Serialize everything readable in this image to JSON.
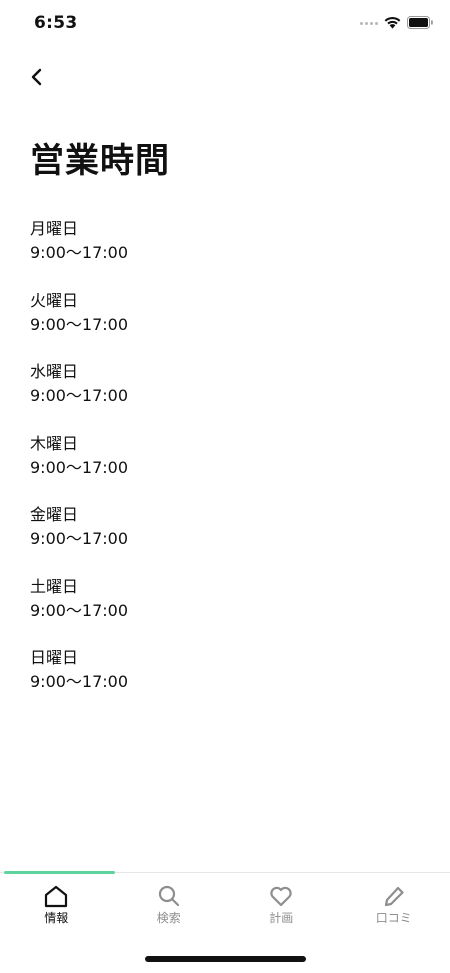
{
  "status_bar": {
    "time": "6:53"
  },
  "page": {
    "title": "営業時間"
  },
  "hours": [
    {
      "day": "月曜日",
      "hours": "9:00〜17:00"
    },
    {
      "day": "火曜日",
      "hours": "9:00〜17:00"
    },
    {
      "day": "水曜日",
      "hours": "9:00〜17:00"
    },
    {
      "day": "木曜日",
      "hours": "9:00〜17:00"
    },
    {
      "day": "金曜日",
      "hours": "9:00〜17:00"
    },
    {
      "day": "土曜日",
      "hours": "9:00〜17:00"
    },
    {
      "day": "日曜日",
      "hours": "9:00〜17:00"
    }
  ],
  "tab_bar": {
    "active_color": "#5fd39c",
    "tabs": [
      {
        "label": "情報",
        "icon": "home-icon",
        "active": true
      },
      {
        "label": "検索",
        "icon": "search-icon",
        "active": false
      },
      {
        "label": "計画",
        "icon": "heart-icon",
        "active": false
      },
      {
        "label": "口コミ",
        "icon": "pencil-icon",
        "active": false
      }
    ]
  }
}
